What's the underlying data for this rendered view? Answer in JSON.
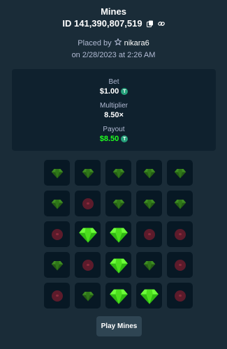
{
  "title": "Mines",
  "bet_id": "ID 141,390,807,519",
  "placed_by_label": "Placed by",
  "username": "nikara6",
  "date": "on 2/28/2023 at 2:26 AM",
  "summary": {
    "bet_label": "Bet",
    "bet_value": "$1.00",
    "multiplier_label": "Multiplier",
    "multiplier_value": "8.50×",
    "payout_label": "Payout",
    "payout_value": "$8.50",
    "currency_icon": "tether-coin-icon",
    "payout_color": "#1fff20"
  },
  "grid": {
    "rows": 5,
    "cols": 5,
    "tiles": [
      "gem-dim",
      "gem-dim",
      "gem-dim",
      "gem-dim",
      "gem-dim",
      "gem-dim",
      "mine-dim",
      "gem-dim",
      "gem-dim",
      "gem-dim",
      "mine-dim",
      "gem",
      "gem",
      "mine-dim",
      "mine-dim",
      "gem-dim",
      "mine-dim",
      "gem",
      "gem-dim",
      "mine-dim",
      "mine-dim",
      "gem-dim",
      "gem",
      "gem",
      "mine-dim"
    ]
  },
  "play_button": "Play Mines",
  "icons": {
    "copy": "copy-icon",
    "link": "link-icon",
    "user": "star-user-icon"
  }
}
